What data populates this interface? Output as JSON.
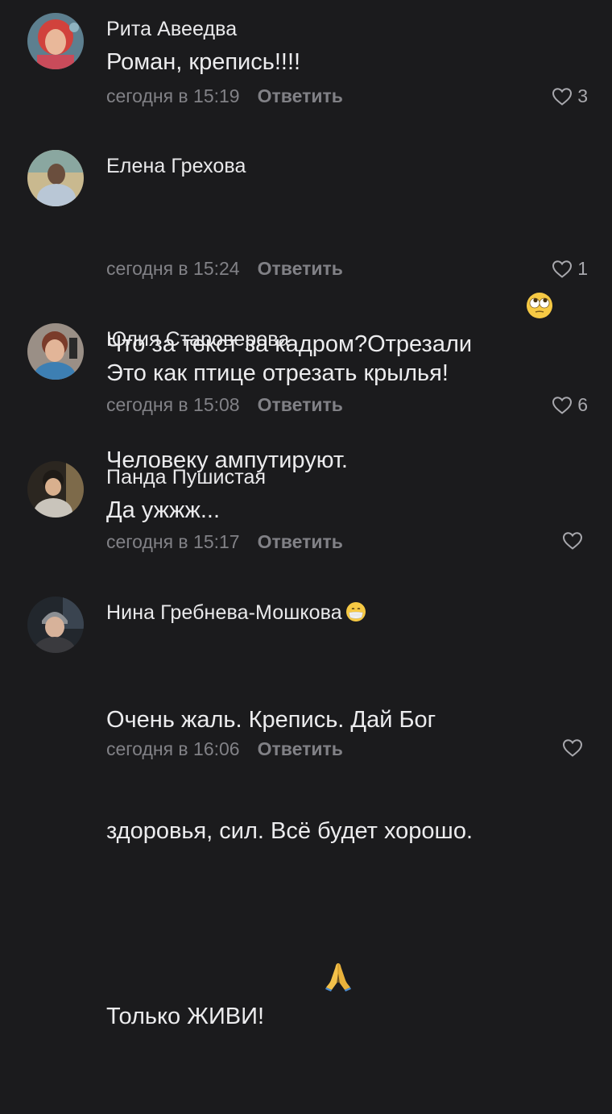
{
  "comments": [
    {
      "author": "Рита Авеедва",
      "text": "Роман, крепись!!!!",
      "time": "сегодня в 15:19",
      "reply_label": "Ответить",
      "likes": "3"
    },
    {
      "author": "Елена Грехова",
      "text_line1": "Что за текст за кадром?Отрезали",
      "text_line2": "Человеку ампутируют.",
      "time": "сегодня в 15:24",
      "reply_label": "Ответить",
      "likes": "1"
    },
    {
      "author": "Юлия Староверова",
      "text": "Это как птице отрезать крылья!",
      "time": "сегодня в 15:08",
      "reply_label": "Ответить",
      "likes": "6"
    },
    {
      "author": "Панда Пушистая",
      "text": "Да ужжж...",
      "time": "сегодня в 15:17",
      "reply_label": "Ответить",
      "likes": ""
    },
    {
      "author": "Нина Гребнева-Мошкова",
      "text_line1": "Очень жаль. Крепись. Дай Бог",
      "text_line2": "здоровья, сил. Всё будет хорошо.",
      "text_line3": "Только ЖИВИ!",
      "time": "сегодня в 16:06",
      "reply_label": "Ответить",
      "likes": ""
    }
  ],
  "icons": {
    "like": "heart-outline-icon",
    "emoji_eye_roll": "face-rolling-eyes-emoji",
    "emoji_mask": "face-with-medical-mask-emoji",
    "emoji_pray": "folded-hands-emoji"
  },
  "colors": {
    "background": "#1b1b1d",
    "author": "#e9e9eb",
    "text": "#ececee",
    "meta": "#818186",
    "like_icon": "#a8a8ad"
  }
}
